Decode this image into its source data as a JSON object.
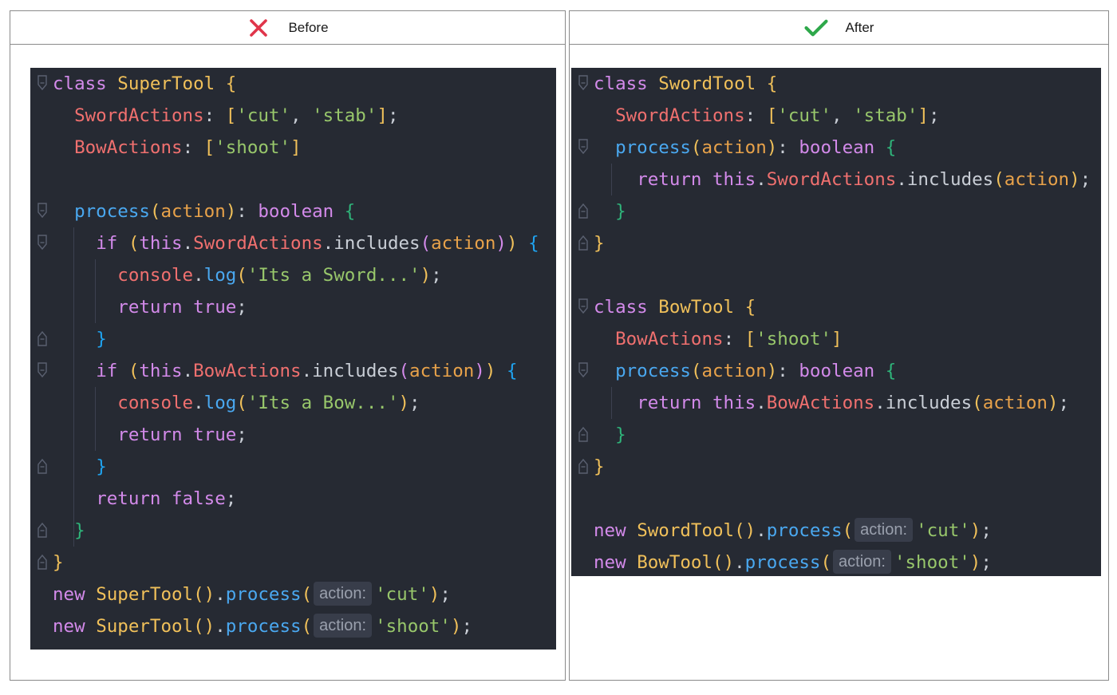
{
  "before": {
    "header_label": "Before",
    "status_icon": "cross-icon",
    "status_color": "#e0354a",
    "hint_label": "action:",
    "code_lines": [
      "class SuperTool {",
      "  SwordActions: ['cut', 'stab'];",
      "  BowActions: ['shoot']",
      "",
      "  process(action): boolean {",
      "    if (this.SwordActions.includes(action)) {",
      "      console.log('Its a Sword...');",
      "      return true;",
      "    }",
      "    if (this.BowActions.includes(action)) {",
      "      console.log('Its a Bow...');",
      "      return true;",
      "    }",
      "    return false;",
      "  }",
      "}",
      "new SuperTool().process(action: 'cut');",
      "new SuperTool().process(action: 'shoot');"
    ]
  },
  "after": {
    "header_label": "After",
    "status_icon": "check-icon",
    "status_color": "#2ea84a",
    "hint_label": "action:",
    "code_lines": [
      "class SwordTool {",
      "  SwordActions: ['cut', 'stab'];",
      "  process(action): boolean {",
      "    return this.SwordActions.includes(action);",
      "  }",
      "}",
      "",
      "class BowTool {",
      "  BowActions: ['shoot']",
      "  process(action): boolean {",
      "    return this.BowActions.includes(action);",
      "  }",
      "}",
      "",
      "new SwordTool().process(action: 'cut');",
      "new BowTool().process(action: 'shoot');"
    ]
  }
}
